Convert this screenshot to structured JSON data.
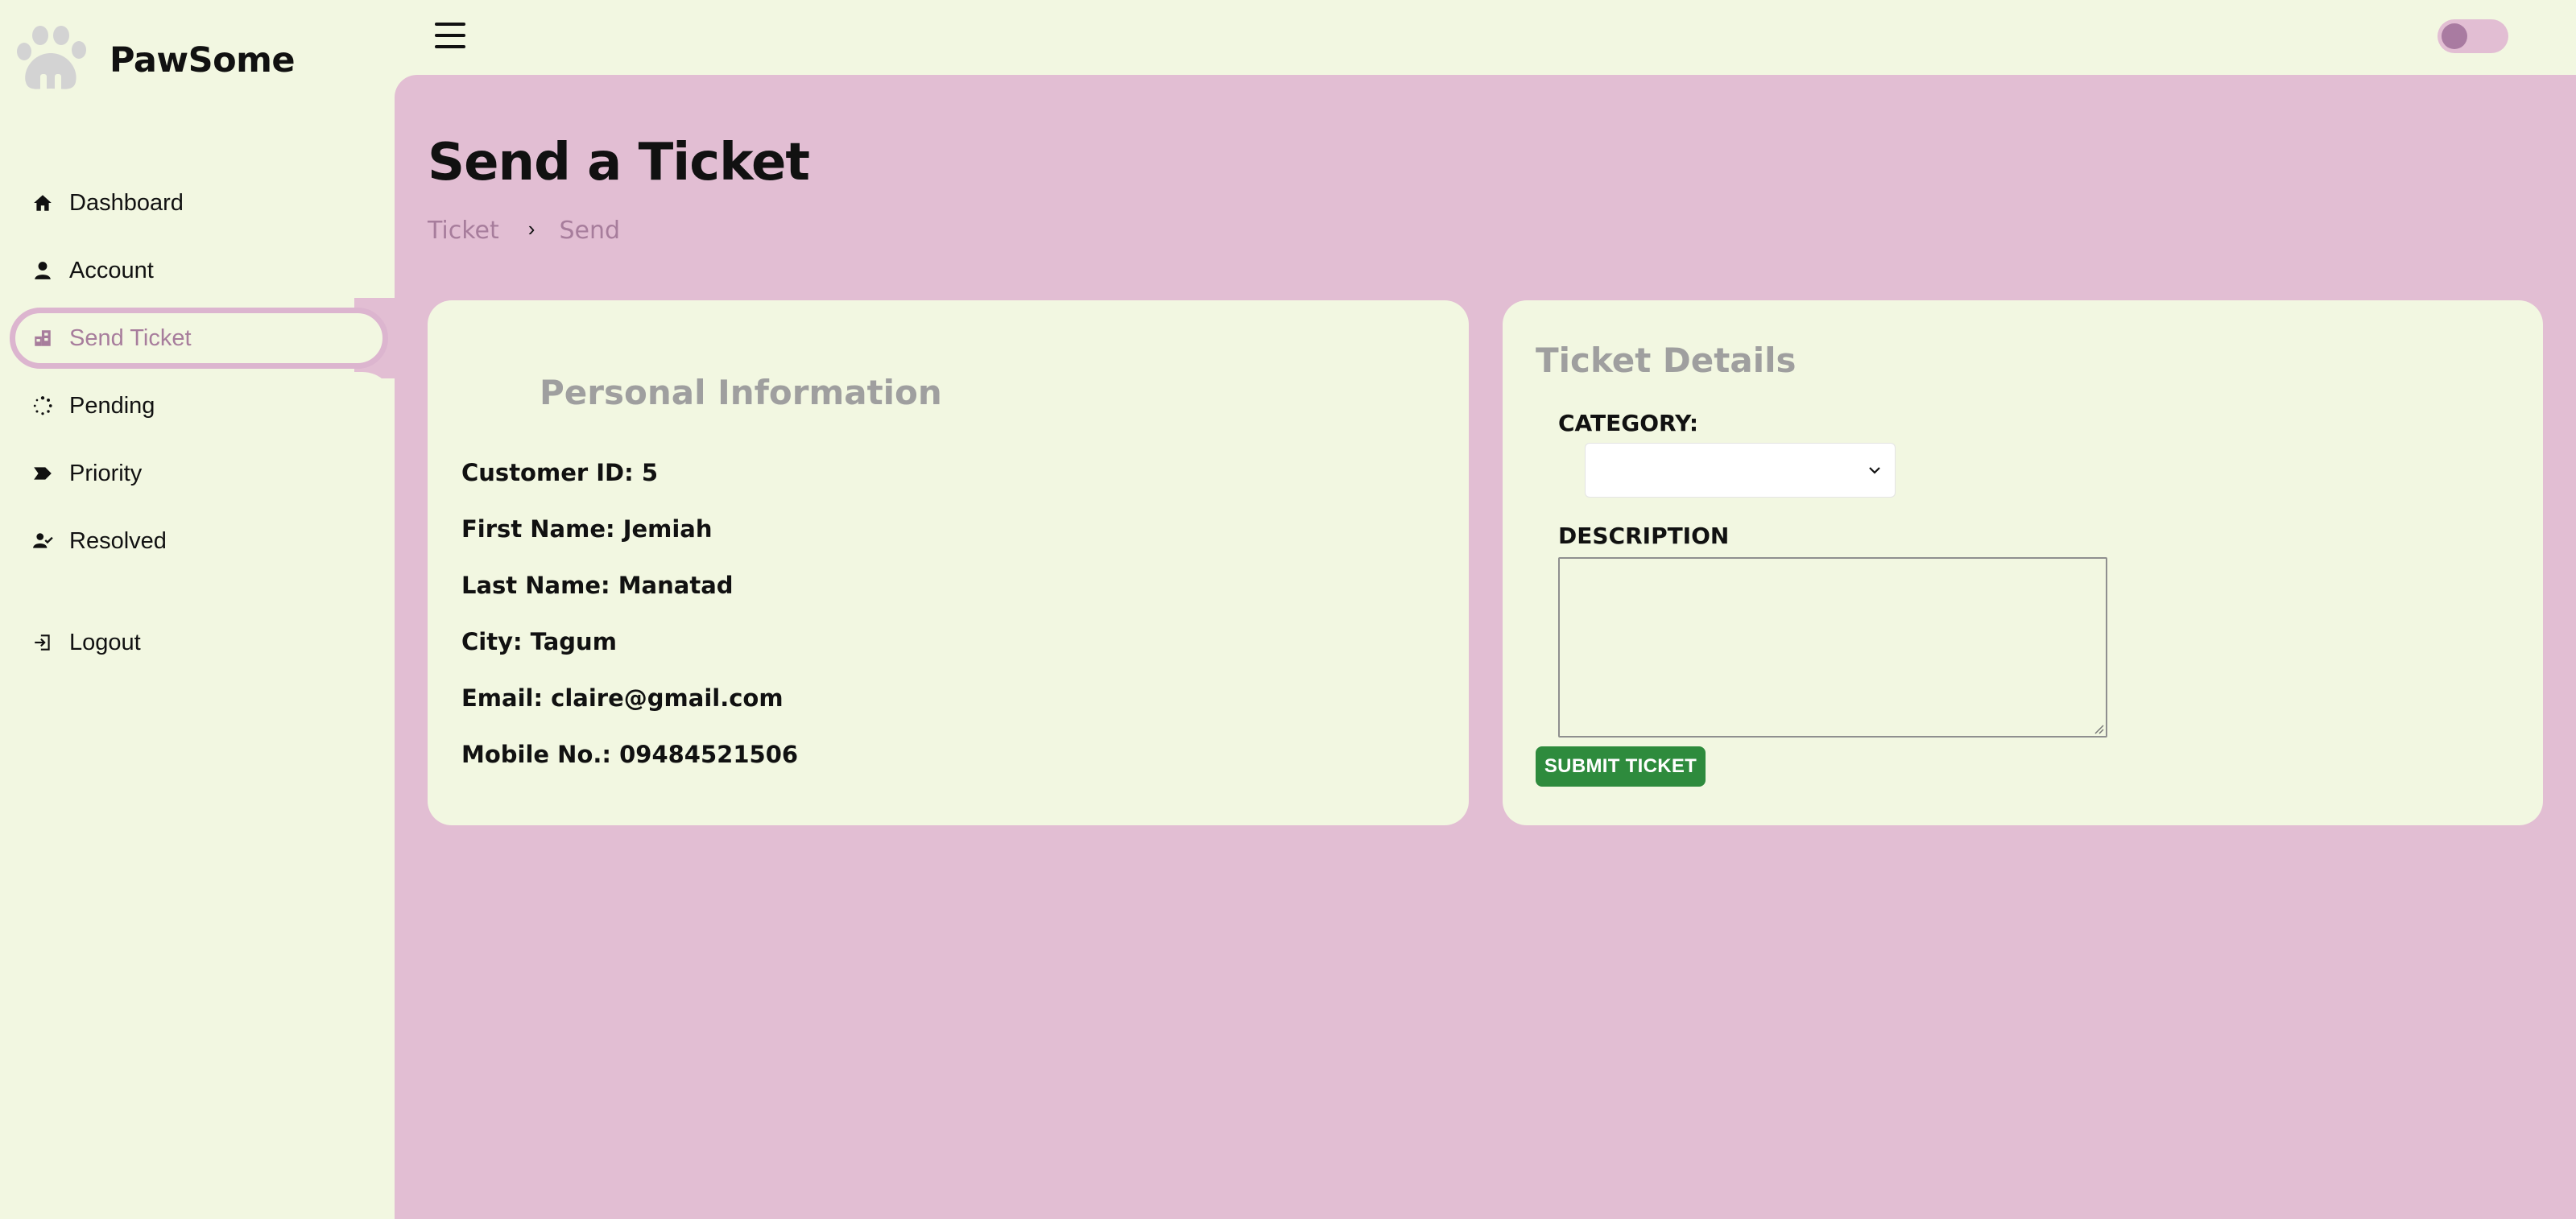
{
  "brand": {
    "name": "PawSome"
  },
  "sidebar": {
    "items": [
      {
        "label": "Dashboard",
        "icon": "home-icon"
      },
      {
        "label": "Account",
        "icon": "user-icon"
      },
      {
        "label": "Send Ticket",
        "icon": "ticket-icon",
        "active": true
      },
      {
        "label": "Pending",
        "icon": "spinner-icon"
      },
      {
        "label": "Priority",
        "icon": "tag-icon"
      },
      {
        "label": "Resolved",
        "icon": "users-check-icon"
      },
      {
        "label": "Logout",
        "icon": "logout-icon"
      }
    ]
  },
  "topbar": {
    "menu_icon": "hamburger-icon",
    "theme_toggle": "off"
  },
  "main": {
    "title": "Send a Ticket",
    "breadcrumb": {
      "items": [
        "Ticket",
        "Send"
      ],
      "separator": "›"
    }
  },
  "personal_info": {
    "title": "Personal Information",
    "rows": [
      "Customer ID: 5",
      "First Name: Jemiah",
      "Last Name: Manatad",
      "City: Tagum",
      "Email: claire@gmail.com",
      "Mobile No.: 09484521506"
    ]
  },
  "ticket_details": {
    "title": "Ticket Details",
    "category_label": "CATEGORY:",
    "category_value": "",
    "description_label": "DESCRIPTION",
    "description_value": "",
    "submit_label": "SUBMIT TICKET"
  },
  "colors": {
    "background": "#f2f7e1",
    "main_panel": "#e2bed3",
    "accent": "#a77d9c",
    "submit": "#2e8b3d"
  }
}
